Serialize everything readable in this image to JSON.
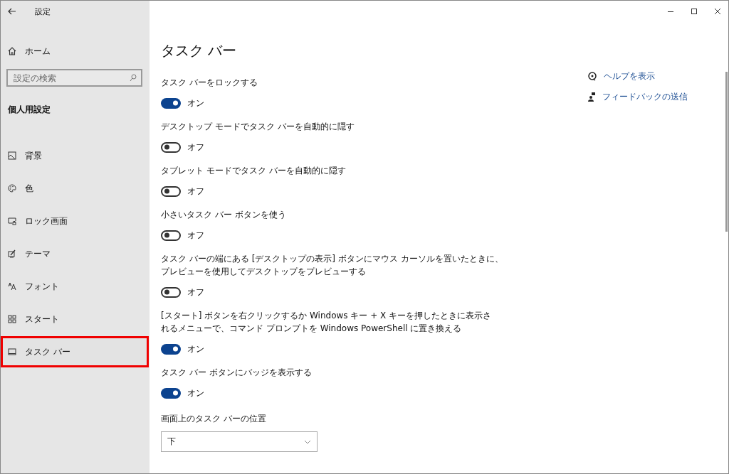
{
  "window": {
    "title": "設定"
  },
  "sidebar": {
    "home": "ホーム",
    "search": {
      "placeholder": "設定の検索"
    },
    "section": "個人用設定",
    "items": [
      {
        "label": "背景",
        "selected": false
      },
      {
        "label": "色",
        "selected": false
      },
      {
        "label": "ロック画面",
        "selected": false
      },
      {
        "label": "テーマ",
        "selected": false
      },
      {
        "label": "フォント",
        "selected": false
      },
      {
        "label": "スタート",
        "selected": false
      },
      {
        "label": "タスク バー",
        "selected": true
      }
    ]
  },
  "page": {
    "title": "タスク バー",
    "settings": [
      {
        "label_lines": [
          "タスク バーをロックする"
        ],
        "on": true,
        "state_text": "オン"
      },
      {
        "label_lines": [
          "デスクトップ モードでタスク バーを自動的に隠す"
        ],
        "on": false,
        "state_text": "オフ"
      },
      {
        "label_lines": [
          "タブレット モードでタスク バーを自動的に隠す"
        ],
        "on": false,
        "state_text": "オフ"
      },
      {
        "label_lines": [
          "小さいタスク バー ボタンを使う"
        ],
        "on": false,
        "state_text": "オフ"
      },
      {
        "label_lines": [
          "タスク バーの端にある [デスクトップの表示] ボタンにマウス カーソルを置いたときに、",
          "プレビューを使用してデスクトップをプレビューする"
        ],
        "on": false,
        "state_text": "オフ"
      },
      {
        "label_lines": [
          "[スタート] ボタンを右クリックするか Windows キー + X キーを押したときに表示さ",
          "れるメニューで、コマンド プロンプトを Windows PowerShell に置き換える"
        ],
        "on": true,
        "state_text": "オン"
      },
      {
        "label_lines": [
          "タスク バー ボタンにバッジを表示する"
        ],
        "on": true,
        "state_text": "オン"
      }
    ],
    "position": {
      "label": "画面上のタスク バーの位置",
      "value": "下"
    }
  },
  "links": [
    {
      "label": "ヘルプを表示"
    },
    {
      "label": "フィードバックの送信"
    }
  ]
}
